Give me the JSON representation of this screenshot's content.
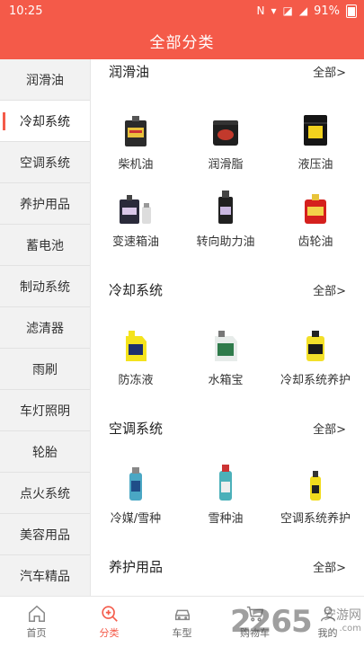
{
  "status_bar": {
    "time": "10:25",
    "battery": "91%"
  },
  "header": {
    "title": "全部分类"
  },
  "sidebar": {
    "items": [
      {
        "label": "润滑油"
      },
      {
        "label": "冷却系统"
      },
      {
        "label": "空调系统"
      },
      {
        "label": "养护用品"
      },
      {
        "label": "蓄电池"
      },
      {
        "label": "制动系统"
      },
      {
        "label": "滤清器"
      },
      {
        "label": "雨刷"
      },
      {
        "label": "车灯照明"
      },
      {
        "label": "轮胎"
      },
      {
        "label": "点火系统"
      },
      {
        "label": "美容用品"
      },
      {
        "label": "汽车精品"
      }
    ],
    "active_index": 1
  },
  "sections": [
    {
      "title": "润滑油",
      "more": "全部>",
      "products": [
        {
          "name": "柴机油",
          "icon": "oil-can-icon"
        },
        {
          "name": "润滑脂",
          "icon": "grease-tub-icon"
        },
        {
          "name": "液压油",
          "icon": "drum-icon"
        },
        {
          "name": "变速箱油",
          "icon": "oil-bottles-icon"
        },
        {
          "name": "转向助力油",
          "icon": "fluid-bottle-icon"
        },
        {
          "name": "齿轮油",
          "icon": "gear-oil-icon"
        }
      ]
    },
    {
      "title": "冷却系统",
      "more": "全部>",
      "products": [
        {
          "name": "防冻液",
          "icon": "antifreeze-jug-icon"
        },
        {
          "name": "水箱宝",
          "icon": "coolant-jug-icon"
        },
        {
          "name": "冷却系统养护",
          "icon": "cooling-care-jug-icon"
        }
      ]
    },
    {
      "title": "空调系统",
      "more": "全部>",
      "products": [
        {
          "name": "冷媒/雪种",
          "icon": "refrigerant-can-icon"
        },
        {
          "name": "雪种油",
          "icon": "refrigerant-oil-can-icon"
        },
        {
          "name": "空调系统养护",
          "icon": "ac-care-spray-icon"
        }
      ]
    },
    {
      "title": "养护用品",
      "more": "全部>",
      "products": []
    }
  ],
  "tabbar": {
    "items": [
      {
        "label": "首页",
        "icon": "home-icon"
      },
      {
        "label": "分类",
        "icon": "category-search-icon"
      },
      {
        "label": "车型",
        "icon": "car-icon"
      },
      {
        "label": "购物车",
        "icon": "cart-icon"
      },
      {
        "label": "我的",
        "icon": "user-icon"
      }
    ],
    "active_index": 1
  },
  "watermark": {
    "number": "2265",
    "text": "安游网",
    "url": ".com"
  },
  "colors": {
    "brand": "#f45a49",
    "sidebar_bg": "#f2f2f2"
  }
}
